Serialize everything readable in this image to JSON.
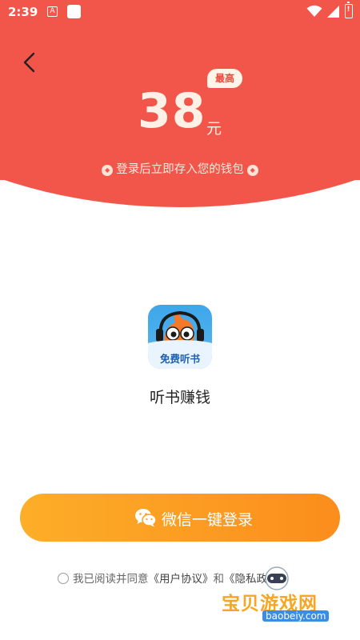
{
  "status_bar": {
    "time": "2:39",
    "notification_letter": "A",
    "battery_level": "!"
  },
  "header": {
    "reward_amount": "38",
    "reward_unit": "元",
    "max_badge": "最高",
    "wallet_note": "登录后立即存入您的钱包"
  },
  "app": {
    "icon_label": "免费听书",
    "name": "听书赚钱"
  },
  "login": {
    "button_label": "微信一键登录"
  },
  "agreement": {
    "prefix": "我已阅读并同意",
    "user_agreement": "《用户协议》",
    "and": "和",
    "privacy_policy": "《隐私政策》"
  },
  "watermark": {
    "text": "宝贝游戏网",
    "url": "baobeiy.com"
  },
  "colors": {
    "header_red": "#f2564a",
    "button_orange_start": "#fdae28",
    "button_orange_end": "#fb8d1c",
    "reward_text": "#fff1e6"
  }
}
